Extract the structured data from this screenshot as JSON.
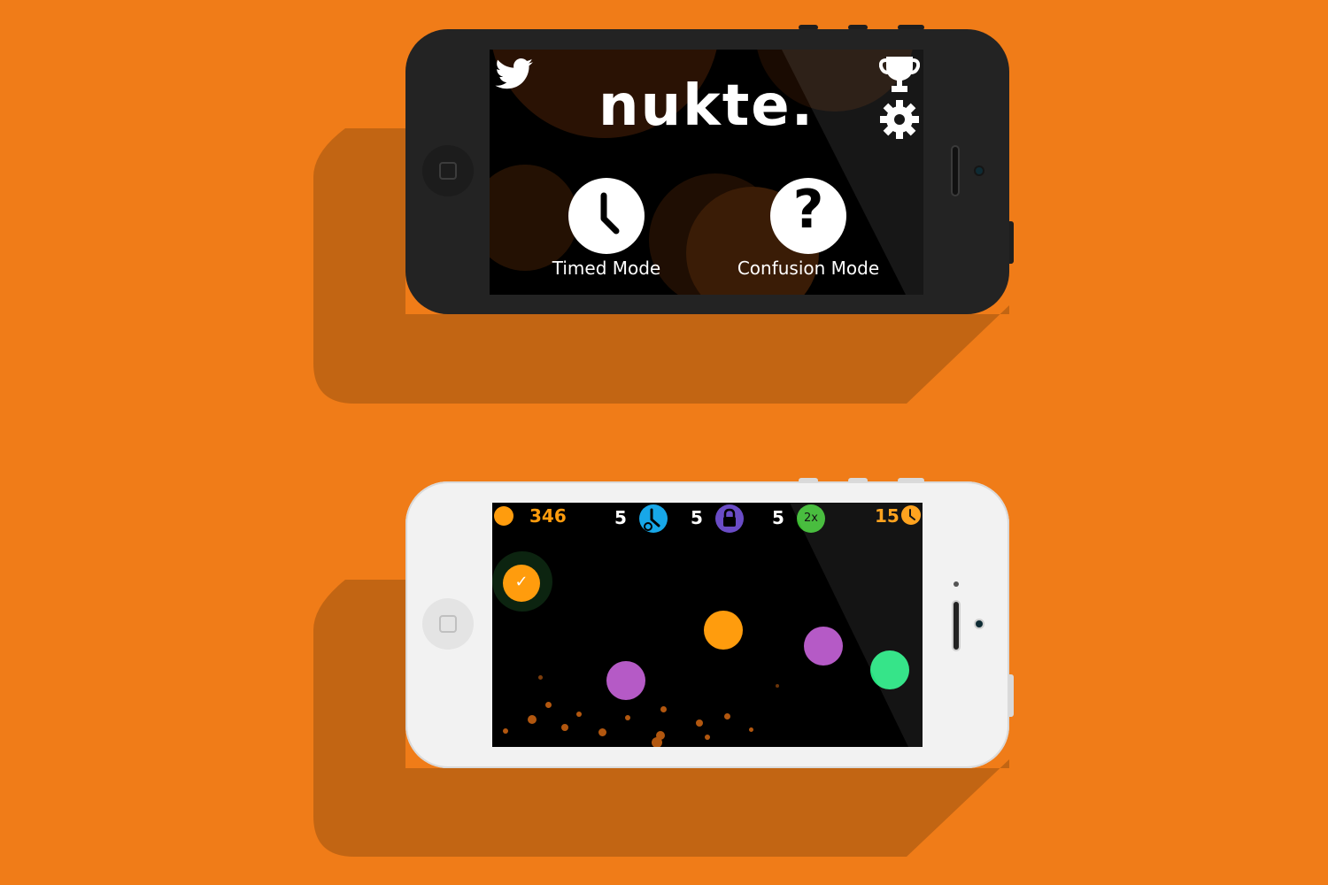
{
  "colors": {
    "background": "#f07c18",
    "long_shadow": "#c26513",
    "accent_orange": "#ff9c0d",
    "purple": "#b55ac6",
    "green": "#25e27f",
    "timer_blue": "#17a7e8",
    "lock_purple": "#6a4cc6",
    "multiplier_green": "#3ab82f"
  },
  "menu_screen": {
    "logo": "nukte.",
    "twitter_icon": "twitter-bird-icon",
    "trophy_icon": "trophy-icon",
    "settings_icon": "gear-icon",
    "modes": [
      {
        "label": "Timed Mode",
        "icon": "clock-icon"
      },
      {
        "label": "Confusion Mode",
        "icon": "question-mark-icon"
      }
    ]
  },
  "game_screen": {
    "score": "346",
    "powerups": [
      {
        "count": "5",
        "icon": "clock-freeze-icon"
      },
      {
        "count": "5",
        "icon": "lock-icon"
      },
      {
        "count": "5",
        "icon": "multiplier-icon",
        "badge": "2x"
      }
    ],
    "timer": "15",
    "timer_icon": "clock-icon",
    "selected_marker": "✓",
    "balls": [
      {
        "color": "orange",
        "selected": true
      },
      {
        "color": "orange",
        "selected": false
      },
      {
        "color": "purple",
        "selected": false
      },
      {
        "color": "purple",
        "selected": false
      },
      {
        "color": "green",
        "selected": false
      }
    ]
  }
}
